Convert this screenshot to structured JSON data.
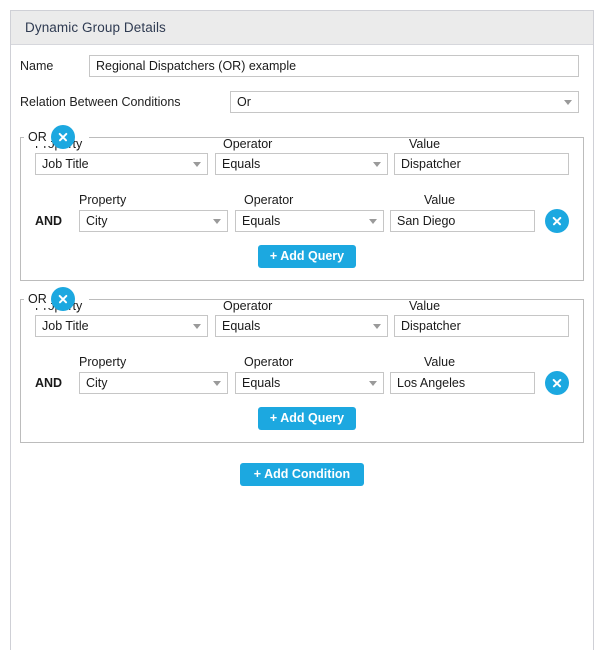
{
  "panel": {
    "header_title": "Dynamic Group Details"
  },
  "form": {
    "name_label": "Name",
    "name_value": "Regional Dispatchers (OR) example",
    "relation_label": "Relation Between Conditions",
    "relation_value": "Or"
  },
  "column_headers": {
    "property": "Property",
    "operator": "Operator",
    "value": "Value"
  },
  "conditions": [
    {
      "legend": "OR",
      "remove_icon": "close-circle-icon",
      "primary_query": {
        "property": "Job Title",
        "operator": "Equals",
        "value": "Dispatcher"
      },
      "sub_queries": [
        {
          "joiner": "AND",
          "property": "City",
          "operator": "Equals",
          "value": "San Diego",
          "remove_icon": "close-circle-icon"
        }
      ],
      "add_query_label": "+ Add Query"
    },
    {
      "legend": "OR",
      "remove_icon": "close-circle-icon",
      "primary_query": {
        "property": "Job Title",
        "operator": "Equals",
        "value": "Dispatcher"
      },
      "sub_queries": [
        {
          "joiner": "AND",
          "property": "City",
          "operator": "Equals",
          "value": "Los Angeles",
          "remove_icon": "close-circle-icon"
        }
      ],
      "add_query_label": "+ Add Query"
    }
  ],
  "footer": {
    "add_condition_label": "+ Add Condition"
  },
  "colors": {
    "accent_blue": "#1ca8e0",
    "header_bg": "#ebebeb",
    "header_text": "#2f3b52",
    "panel_border": "#cfd0d6",
    "field_border": "#c6c6c6"
  }
}
